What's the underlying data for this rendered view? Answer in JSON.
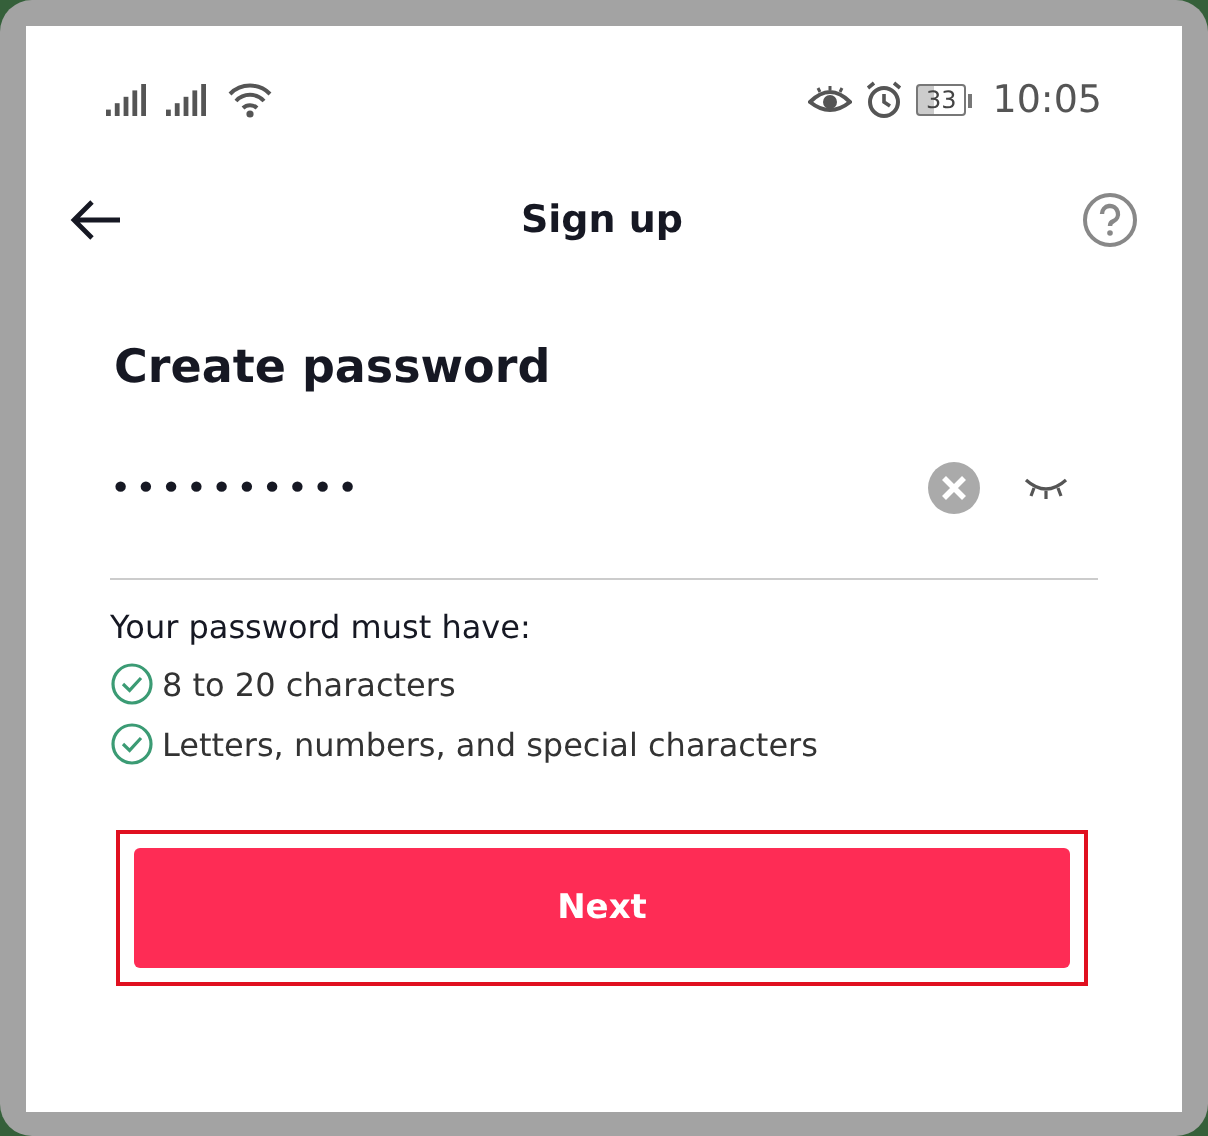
{
  "status_bar": {
    "battery": "33",
    "time": "10:05"
  },
  "header": {
    "title": "Sign up"
  },
  "heading": "Create password",
  "password_field": {
    "value": "••••••••••",
    "show_password": false
  },
  "requirements": {
    "title": "Your password must have:",
    "items": [
      {
        "text": "8 to 20 characters",
        "met": true
      },
      {
        "text": "Letters, numbers, and special characters",
        "met": true
      }
    ]
  },
  "next_button": {
    "label": "Next",
    "highlighted": true
  }
}
